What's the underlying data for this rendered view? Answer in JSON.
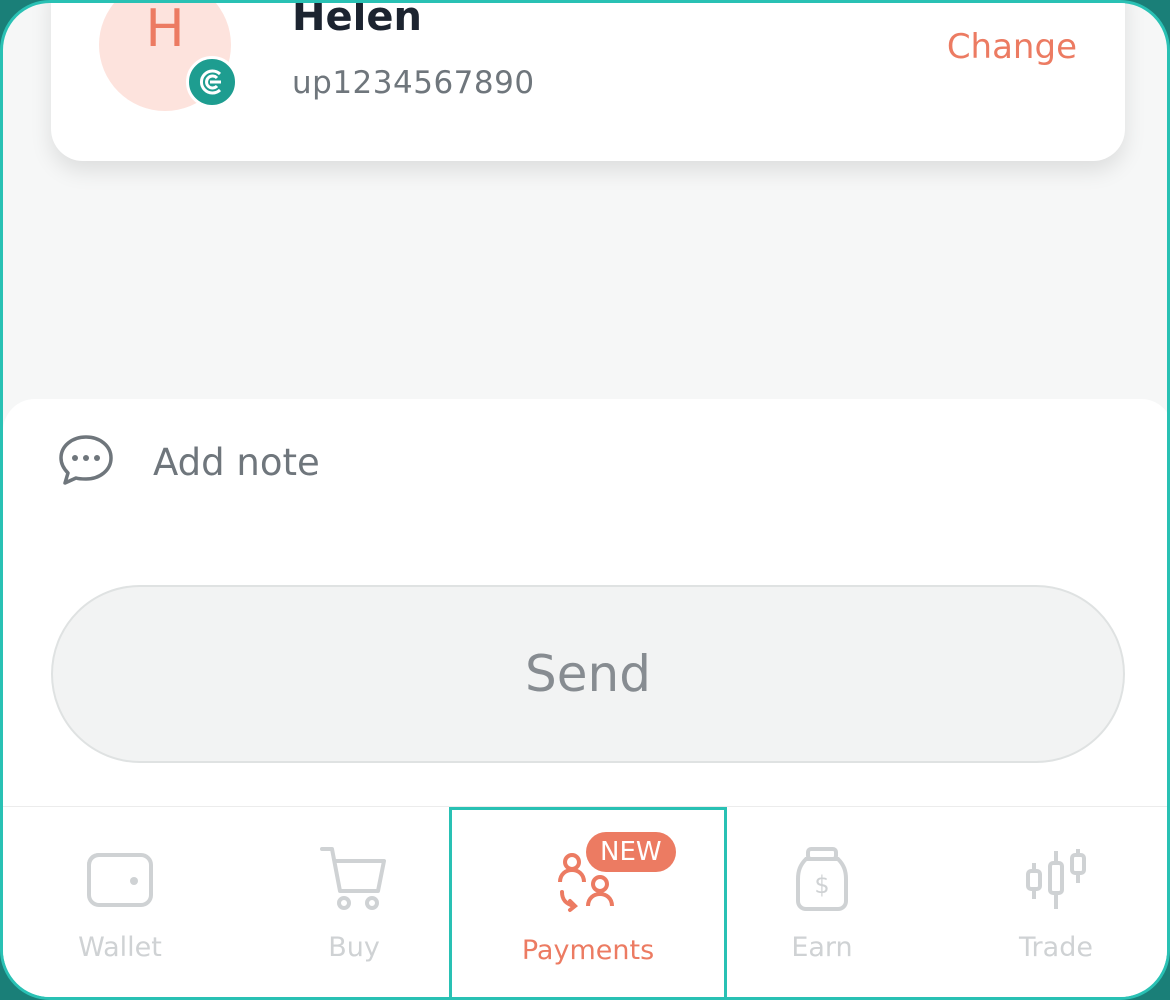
{
  "recipient": {
    "avatar_letter": "H",
    "name": "Helen",
    "user_id": "up1234567890",
    "change_label": "Change",
    "badge_icon": "coin-logo-icon"
  },
  "note": {
    "icon": "chat-bubble-icon",
    "label": "Add note"
  },
  "send": {
    "label": "Send"
  },
  "tabs": [
    {
      "label": "Wallet",
      "icon": "wallet-icon",
      "active": false
    },
    {
      "label": "Buy",
      "icon": "cart-icon",
      "active": false
    },
    {
      "label": "Payments",
      "icon": "payments-icon",
      "active": true,
      "badge": "NEW"
    },
    {
      "label": "Earn",
      "icon": "money-jar-icon",
      "active": false
    },
    {
      "label": "Trade",
      "icon": "candlestick-icon",
      "active": false
    }
  ],
  "colors": {
    "accent": "#ec7b62",
    "highlight": "#29c1b4",
    "inactive": "#cfd2d4"
  }
}
